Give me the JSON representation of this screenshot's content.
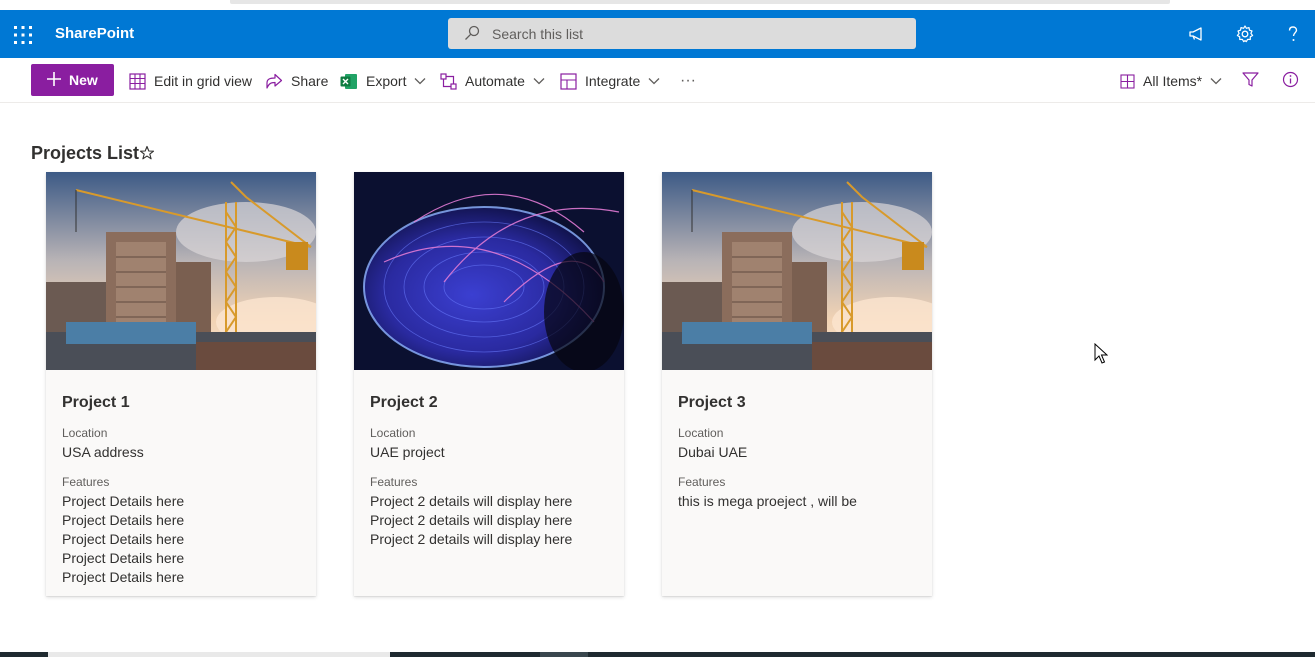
{
  "app": {
    "name": "SharePoint"
  },
  "search": {
    "placeholder": "Search this list"
  },
  "toolbar": {
    "new_label": "New",
    "edit_grid_label": "Edit in grid view",
    "share_label": "Share",
    "export_label": "Export",
    "automate_label": "Automate",
    "integrate_label": "Integrate",
    "more_label": "···",
    "view_label": "All Items*"
  },
  "page": {
    "title": "Projects List"
  },
  "cards": [
    {
      "title": "Project 1",
      "location_label": "Location",
      "location": "USA address",
      "features_label": "Features",
      "features": [
        "Project Details here",
        "Project Details here",
        "Project Details here",
        "Project Details here",
        "Project Details here"
      ],
      "image": "construction-crane-image"
    },
    {
      "title": "Project 2",
      "location_label": "Location",
      "location": "UAE project",
      "features_label": "Features",
      "features": [
        "Project 2 details will display here",
        "Project 2 details will display here",
        "Project 2 details will display here"
      ],
      "image": "digital-globe-image"
    },
    {
      "title": "Project 3",
      "location_label": "Location",
      "location": "Dubai UAE",
      "features_label": "Features",
      "features": [
        "this is mega proeject , will be"
      ],
      "image": "construction-crane-image"
    }
  ],
  "icons": {
    "app_launcher": "waffle-icon",
    "search": "search-icon",
    "feedback": "megaphone-icon",
    "settings": "gear-icon",
    "help": "help-icon",
    "filter": "filter-icon",
    "info": "info-icon",
    "favorite": "star-icon"
  },
  "colors": {
    "suite_bar": "#0078d4",
    "new_button": "#8a1ea0",
    "accent_icons": "#8a1ea0",
    "excel": "#1d7a43",
    "card_background": "#faf9f8"
  }
}
